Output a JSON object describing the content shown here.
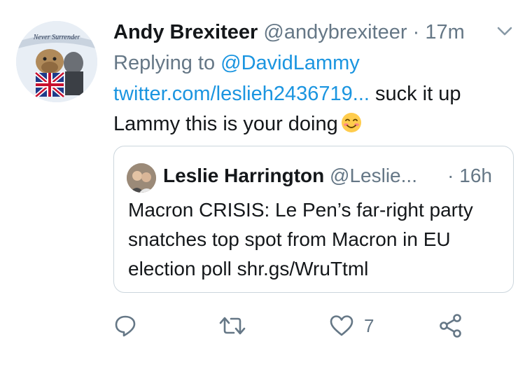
{
  "tweet": {
    "avatar_icon": "bulldog-union-jack-avatar",
    "avatar_banner_text": "Never Surrender",
    "display_name": "Andy Brexiteer",
    "handle": "@andybrexiteer",
    "separator": "·",
    "time": "17m",
    "menu_icon": "chevron-down-icon",
    "replying_to_label": "Replying to",
    "replying_to_handle": "@DavidLammy",
    "link_text": "twitter.com/leslieh2436719...",
    "text_after_link": " suck it up Lammy this is your doing",
    "emoji": "smiling-face-with-smiling-eyes"
  },
  "quoted_tweet": {
    "avatar_icon": "user-avatar",
    "display_name": "Leslie Harrington",
    "handle": "@Leslie...",
    "time": "· 16h",
    "text": "Macron CRISIS: Le Pen’s far-right party snatches top spot from Macron in EU election poll shr.gs/WruTtml"
  },
  "actions": {
    "reply_icon": "reply-icon",
    "retweet_icon": "retweet-icon",
    "like_icon": "heart-icon",
    "like_count": "7",
    "share_icon": "share-icon"
  },
  "colors": {
    "primary_text": "#14171a",
    "secondary_text": "#657786",
    "link": "#1b95e0",
    "border": "#ccd6dd"
  }
}
